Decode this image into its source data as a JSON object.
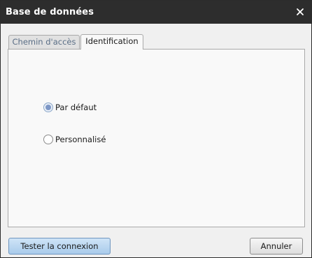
{
  "window": {
    "title": "Base de données",
    "close_icon": "close-icon"
  },
  "tabs": [
    {
      "label": "Chemin d'accès",
      "active": false
    },
    {
      "label": "Identification",
      "active": true
    }
  ],
  "identification": {
    "options": [
      {
        "label": "Par défaut",
        "checked": true
      },
      {
        "label": "Personnalisé",
        "checked": false
      }
    ]
  },
  "footer": {
    "test_label": "Tester la connexion",
    "cancel_label": "Annuler"
  },
  "colors": {
    "titlebar": "#2d2d2d",
    "radio_checked": "#7d97c6",
    "primary_button": "#a9cbeb"
  }
}
